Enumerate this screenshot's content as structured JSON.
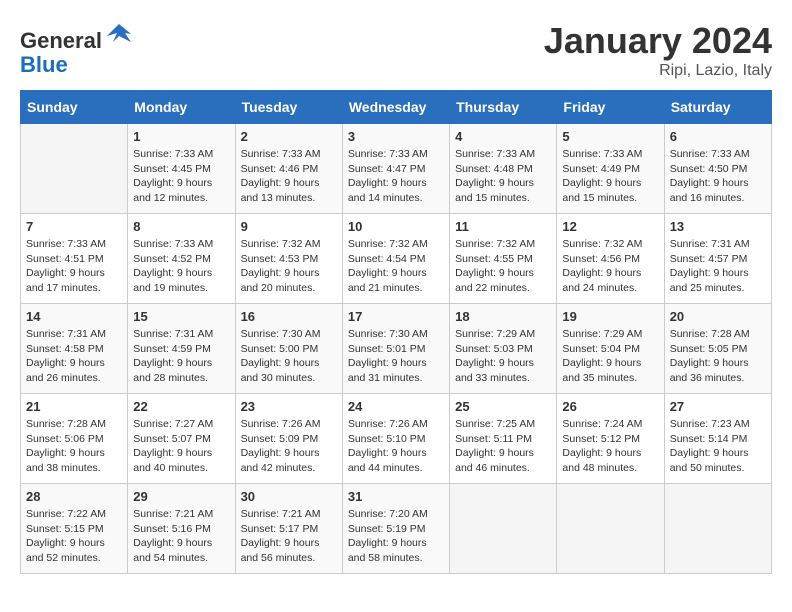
{
  "header": {
    "logo_line1": "General",
    "logo_line2": "Blue",
    "month": "January 2024",
    "location": "Ripi, Lazio, Italy"
  },
  "weekdays": [
    "Sunday",
    "Monday",
    "Tuesday",
    "Wednesday",
    "Thursday",
    "Friday",
    "Saturday"
  ],
  "weeks": [
    [
      {
        "day": "",
        "sunrise": "",
        "sunset": "",
        "daylight": ""
      },
      {
        "day": "1",
        "sunrise": "Sunrise: 7:33 AM",
        "sunset": "Sunset: 4:45 PM",
        "daylight": "Daylight: 9 hours and 12 minutes."
      },
      {
        "day": "2",
        "sunrise": "Sunrise: 7:33 AM",
        "sunset": "Sunset: 4:46 PM",
        "daylight": "Daylight: 9 hours and 13 minutes."
      },
      {
        "day": "3",
        "sunrise": "Sunrise: 7:33 AM",
        "sunset": "Sunset: 4:47 PM",
        "daylight": "Daylight: 9 hours and 14 minutes."
      },
      {
        "day": "4",
        "sunrise": "Sunrise: 7:33 AM",
        "sunset": "Sunset: 4:48 PM",
        "daylight": "Daylight: 9 hours and 15 minutes."
      },
      {
        "day": "5",
        "sunrise": "Sunrise: 7:33 AM",
        "sunset": "Sunset: 4:49 PM",
        "daylight": "Daylight: 9 hours and 15 minutes."
      },
      {
        "day": "6",
        "sunrise": "Sunrise: 7:33 AM",
        "sunset": "Sunset: 4:50 PM",
        "daylight": "Daylight: 9 hours and 16 minutes."
      }
    ],
    [
      {
        "day": "7",
        "sunrise": "Sunrise: 7:33 AM",
        "sunset": "Sunset: 4:51 PM",
        "daylight": "Daylight: 9 hours and 17 minutes."
      },
      {
        "day": "8",
        "sunrise": "Sunrise: 7:33 AM",
        "sunset": "Sunset: 4:52 PM",
        "daylight": "Daylight: 9 hours and 19 minutes."
      },
      {
        "day": "9",
        "sunrise": "Sunrise: 7:32 AM",
        "sunset": "Sunset: 4:53 PM",
        "daylight": "Daylight: 9 hours and 20 minutes."
      },
      {
        "day": "10",
        "sunrise": "Sunrise: 7:32 AM",
        "sunset": "Sunset: 4:54 PM",
        "daylight": "Daylight: 9 hours and 21 minutes."
      },
      {
        "day": "11",
        "sunrise": "Sunrise: 7:32 AM",
        "sunset": "Sunset: 4:55 PM",
        "daylight": "Daylight: 9 hours and 22 minutes."
      },
      {
        "day": "12",
        "sunrise": "Sunrise: 7:32 AM",
        "sunset": "Sunset: 4:56 PM",
        "daylight": "Daylight: 9 hours and 24 minutes."
      },
      {
        "day": "13",
        "sunrise": "Sunrise: 7:31 AM",
        "sunset": "Sunset: 4:57 PM",
        "daylight": "Daylight: 9 hours and 25 minutes."
      }
    ],
    [
      {
        "day": "14",
        "sunrise": "Sunrise: 7:31 AM",
        "sunset": "Sunset: 4:58 PM",
        "daylight": "Daylight: 9 hours and 26 minutes."
      },
      {
        "day": "15",
        "sunrise": "Sunrise: 7:31 AM",
        "sunset": "Sunset: 4:59 PM",
        "daylight": "Daylight: 9 hours and 28 minutes."
      },
      {
        "day": "16",
        "sunrise": "Sunrise: 7:30 AM",
        "sunset": "Sunset: 5:00 PM",
        "daylight": "Daylight: 9 hours and 30 minutes."
      },
      {
        "day": "17",
        "sunrise": "Sunrise: 7:30 AM",
        "sunset": "Sunset: 5:01 PM",
        "daylight": "Daylight: 9 hours and 31 minutes."
      },
      {
        "day": "18",
        "sunrise": "Sunrise: 7:29 AM",
        "sunset": "Sunset: 5:03 PM",
        "daylight": "Daylight: 9 hours and 33 minutes."
      },
      {
        "day": "19",
        "sunrise": "Sunrise: 7:29 AM",
        "sunset": "Sunset: 5:04 PM",
        "daylight": "Daylight: 9 hours and 35 minutes."
      },
      {
        "day": "20",
        "sunrise": "Sunrise: 7:28 AM",
        "sunset": "Sunset: 5:05 PM",
        "daylight": "Daylight: 9 hours and 36 minutes."
      }
    ],
    [
      {
        "day": "21",
        "sunrise": "Sunrise: 7:28 AM",
        "sunset": "Sunset: 5:06 PM",
        "daylight": "Daylight: 9 hours and 38 minutes."
      },
      {
        "day": "22",
        "sunrise": "Sunrise: 7:27 AM",
        "sunset": "Sunset: 5:07 PM",
        "daylight": "Daylight: 9 hours and 40 minutes."
      },
      {
        "day": "23",
        "sunrise": "Sunrise: 7:26 AM",
        "sunset": "Sunset: 5:09 PM",
        "daylight": "Daylight: 9 hours and 42 minutes."
      },
      {
        "day": "24",
        "sunrise": "Sunrise: 7:26 AM",
        "sunset": "Sunset: 5:10 PM",
        "daylight": "Daylight: 9 hours and 44 minutes."
      },
      {
        "day": "25",
        "sunrise": "Sunrise: 7:25 AM",
        "sunset": "Sunset: 5:11 PM",
        "daylight": "Daylight: 9 hours and 46 minutes."
      },
      {
        "day": "26",
        "sunrise": "Sunrise: 7:24 AM",
        "sunset": "Sunset: 5:12 PM",
        "daylight": "Daylight: 9 hours and 48 minutes."
      },
      {
        "day": "27",
        "sunrise": "Sunrise: 7:23 AM",
        "sunset": "Sunset: 5:14 PM",
        "daylight": "Daylight: 9 hours and 50 minutes."
      }
    ],
    [
      {
        "day": "28",
        "sunrise": "Sunrise: 7:22 AM",
        "sunset": "Sunset: 5:15 PM",
        "daylight": "Daylight: 9 hours and 52 minutes."
      },
      {
        "day": "29",
        "sunrise": "Sunrise: 7:21 AM",
        "sunset": "Sunset: 5:16 PM",
        "daylight": "Daylight: 9 hours and 54 minutes."
      },
      {
        "day": "30",
        "sunrise": "Sunrise: 7:21 AM",
        "sunset": "Sunset: 5:17 PM",
        "daylight": "Daylight: 9 hours and 56 minutes."
      },
      {
        "day": "31",
        "sunrise": "Sunrise: 7:20 AM",
        "sunset": "Sunset: 5:19 PM",
        "daylight": "Daylight: 9 hours and 58 minutes."
      },
      {
        "day": "",
        "sunrise": "",
        "sunset": "",
        "daylight": ""
      },
      {
        "day": "",
        "sunrise": "",
        "sunset": "",
        "daylight": ""
      },
      {
        "day": "",
        "sunrise": "",
        "sunset": "",
        "daylight": ""
      }
    ]
  ]
}
